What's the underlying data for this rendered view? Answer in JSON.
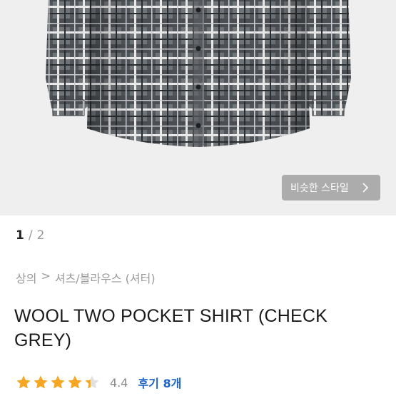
{
  "product": {
    "similar_style_label": "비슷한 스타일",
    "image_pager": {
      "current": "1",
      "separator": "/",
      "total": "2"
    },
    "breadcrumb": {
      "category": "상의",
      "arrow": ">",
      "subcategory": "셔츠/블라우스 (셔터)"
    },
    "title": "WOOL TWO POCKET SHIRT (CHECK GREY)",
    "rating": {
      "value": "4.4",
      "stars": 4.4,
      "max_stars": 5,
      "star_color": "#f5a623"
    },
    "reviews_label": "후기 8개"
  },
  "icons": {
    "chevron": "chevron-right-icon",
    "star": "star-icon"
  },
  "colors": {
    "accent": "#1e64c8",
    "image_bg": "#efefef"
  }
}
